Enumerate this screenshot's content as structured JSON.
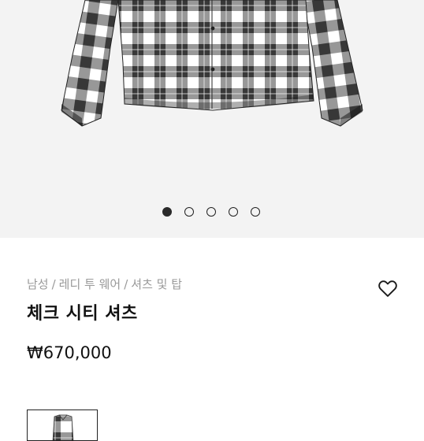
{
  "gallery": {
    "slide_count": 5,
    "active_index": 0
  },
  "product": {
    "breadcrumb": [
      "남성",
      "레디 투 웨어",
      "셔츠 및 탑"
    ],
    "breadcrumb_separator": "/",
    "title": "체크 시티 셔츠",
    "price": "₩670,000"
  },
  "icons": {
    "wishlist": "heart-outline-icon",
    "thumbnail": "shirt-thumbnail"
  },
  "colors": {
    "gallery_background": "#f3f3f3",
    "text_primary": "#111111",
    "text_muted": "#9a9a9a",
    "check_dark": "#1a1a1a",
    "check_light": "#ffffff"
  }
}
